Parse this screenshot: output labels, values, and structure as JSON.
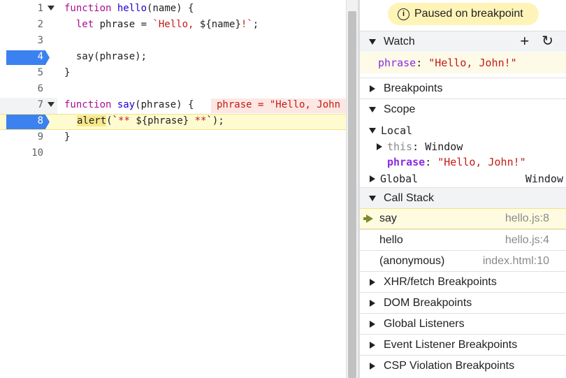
{
  "editor": {
    "lines": [
      {
        "num": "1",
        "code_parts": [
          [
            "kw",
            "function"
          ],
          [
            "",
            "  "
          ],
          [
            "fn",
            "hello"
          ],
          [
            "",
            "(name) {"
          ]
        ]
      },
      {
        "num": "2",
        "code_parts": [
          [
            "",
            "  "
          ],
          [
            "kw",
            "let"
          ],
          [
            "",
            ""
          ],
          [
            "",
            "  phrase = "
          ],
          [
            "str",
            "`Hello, "
          ],
          [
            "",
            "${name}"
          ],
          [
            "str",
            "!`"
          ],
          [
            "",
            ";"
          ]
        ]
      },
      {
        "num": "3"
      },
      {
        "num": "4",
        "code": "  say(phrase);"
      },
      {
        "num": "5",
        "code": "}"
      },
      {
        "num": "6"
      },
      {
        "num": "7",
        "inline_value": "phrase = \"Hello, John"
      },
      {
        "num": "8",
        "alert_call": "alert",
        "alert_rest": "(`** ${phrase} **`);"
      },
      {
        "num": "9",
        "code": "}"
      },
      {
        "num": "10"
      }
    ],
    "line1": {
      "kw": "function",
      "name": "hello",
      "rest": "(name) {"
    },
    "line2": {
      "kw": "let",
      "rest": " phrase = ",
      "str1": "`Hello, ",
      "interp": "${name}",
      "str2": "!`",
      "end": ";"
    },
    "line4": "  say(phrase);",
    "line5": "}",
    "line7": {
      "kw": "function",
      "name": "say",
      "rest": "(phrase) {",
      "inline_value": "phrase = \"Hello, John"
    },
    "line8": {
      "call": "alert",
      "open": "(`",
      "str1": "** ",
      "interp": "${phrase}",
      "str2": " **",
      "close": "`);"
    },
    "line9": "}",
    "line_numbers": [
      "1",
      "2",
      "3",
      "4",
      "5",
      "6",
      "7",
      "8",
      "9",
      "10"
    ],
    "breakpoint_lines": [
      4,
      8
    ],
    "paused_line": 8
  },
  "debugger": {
    "paused_banner": "Paused on breakpoint",
    "info_icon_glyph": "i",
    "watch": {
      "label": "Watch",
      "add_glyph": "+",
      "refresh_glyph": "↻",
      "expr": "phrase",
      "value": "\"Hello, John!\""
    },
    "breakpoints_label": "Breakpoints",
    "scope": {
      "label": "Scope",
      "local_label": "Local",
      "this_key": "this",
      "this_value": "Window",
      "phrase_key": "phrase",
      "phrase_value": "\"Hello, John!\"",
      "global_label": "Global",
      "global_value": "Window"
    },
    "call_stack": {
      "label": "Call Stack",
      "frames": [
        {
          "name": "say",
          "location": "hello.js:8",
          "current": true
        },
        {
          "name": "hello",
          "location": "hello.js:4",
          "current": false
        },
        {
          "name": "(anonymous)",
          "location": "index.html:10",
          "current": false
        }
      ]
    },
    "collapsed_sections": [
      "XHR/fetch Breakpoints",
      "DOM Breakpoints",
      "Global Listeners",
      "Event Listener Breakpoints",
      "CSP Violation Breakpoints"
    ]
  },
  "colors": {
    "breakpoint": "#3b82f0",
    "paused_line_bg": "#fffbd0",
    "paused_banner_bg": "#fff4b8",
    "keyword": "#aa0d91",
    "string": "#c41a16",
    "property": "#8a2be2"
  }
}
